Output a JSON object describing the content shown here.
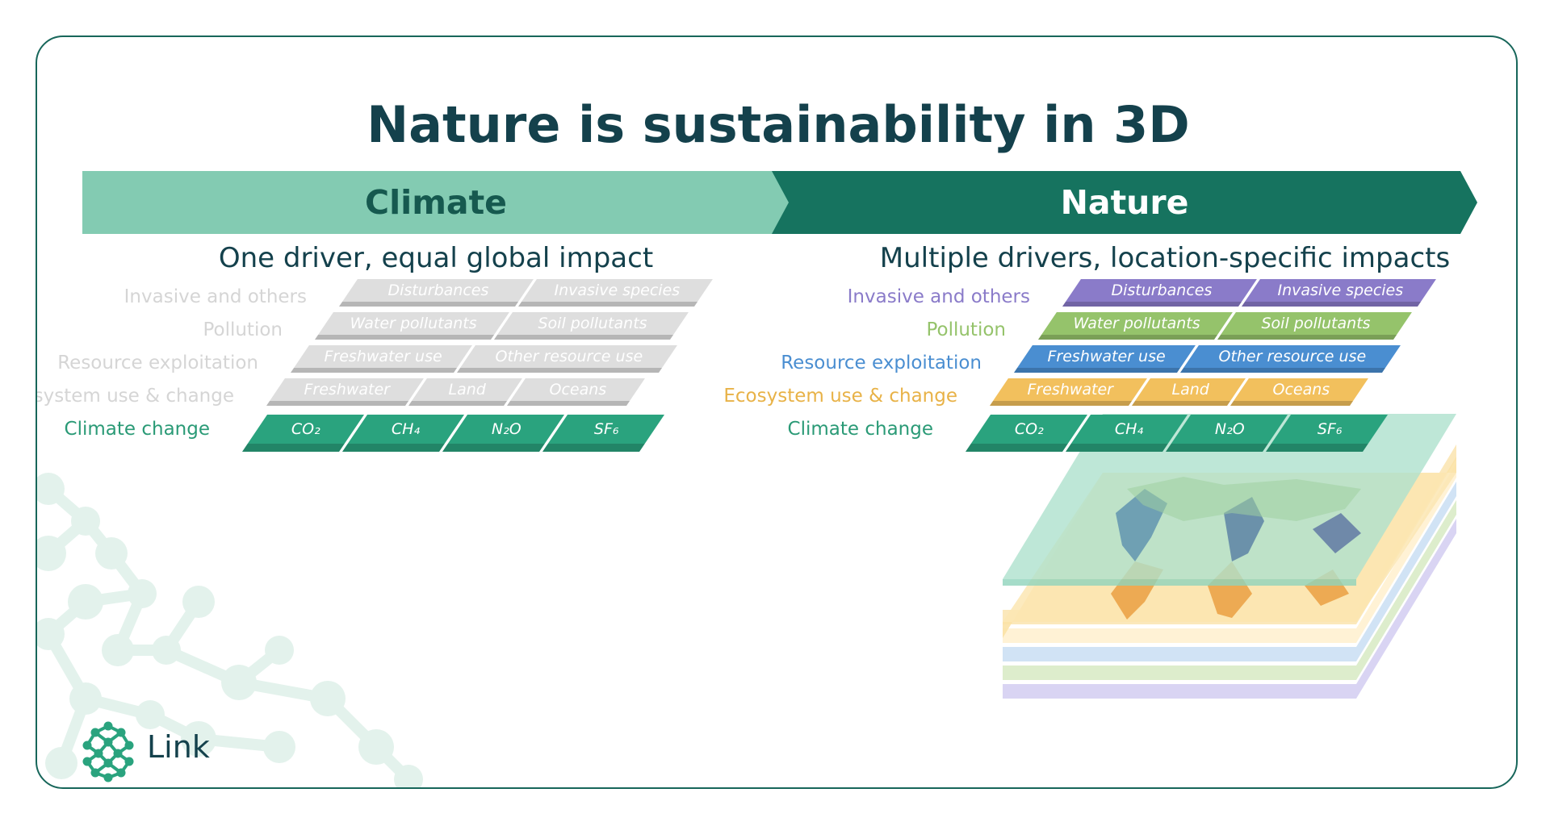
{
  "title": "Nature is sustainability in 3D",
  "climate": {
    "heading": "Climate",
    "subtitle": "One driver, equal global impact",
    "rows": [
      {
        "label": "Invasive and others",
        "tiles": [
          "Disturbances",
          "Invasive species"
        ]
      },
      {
        "label": "Pollution",
        "tiles": [
          "Water pollutants",
          "Soil pollutants"
        ]
      },
      {
        "label": "Resource exploitation",
        "tiles": [
          "Freshwater use",
          "Other resource use"
        ]
      },
      {
        "label": "Ecosystem use & change",
        "tiles": [
          "Freshwater",
          "Land",
          "Oceans"
        ]
      },
      {
        "label": "Climate change",
        "tiles": [
          "CO₂",
          "CH₄",
          "N₂O",
          "SF₆"
        ]
      }
    ]
  },
  "nature": {
    "heading": "Nature",
    "subtitle": "Multiple drivers, location-specific impacts",
    "rows": [
      {
        "label": "Invasive and others",
        "tiles": [
          "Disturbances",
          "Invasive species"
        ]
      },
      {
        "label": "Pollution",
        "tiles": [
          "Water pollutants",
          "Soil pollutants"
        ]
      },
      {
        "label": "Resource exploitation",
        "tiles": [
          "Freshwater use",
          "Other resource use"
        ]
      },
      {
        "label": "Ecosystem use & change",
        "tiles": [
          "Freshwater",
          "Land",
          "Oceans"
        ]
      },
      {
        "label": "Climate change",
        "tiles": [
          "CO₂",
          "CH₄",
          "N₂O",
          "SF₆"
        ]
      }
    ]
  },
  "colors": {
    "invasive": "#8a7bc9",
    "pollution": "#95c36b",
    "resource": "#4a8ed1",
    "ecosystem": "#f2c05d",
    "climate": "#2aa37e",
    "gray_tile": "#dedede",
    "gray_label": "#d5d5d5",
    "frame": "#17665a",
    "title": "#14414c"
  },
  "logo": {
    "text": "Link"
  }
}
